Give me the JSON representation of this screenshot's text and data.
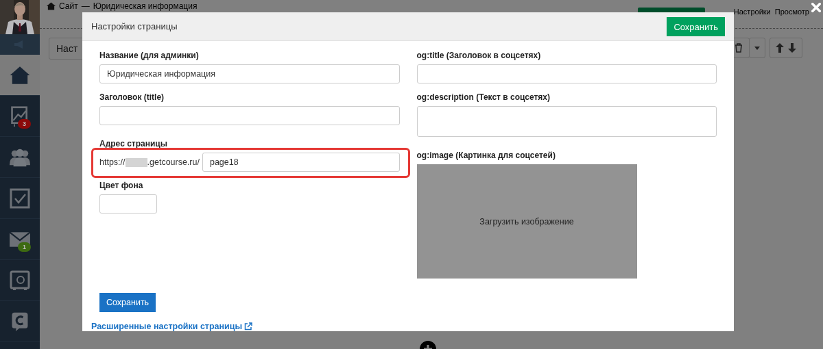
{
  "top_bar": {
    "breadcrumb": [
      "Сайт",
      "—",
      "Юридическая информация"
    ],
    "settings_link": "Настройки",
    "preview_link": "Просмотр"
  },
  "toolbar": {
    "settings_button": "Наст"
  },
  "sidebar": {
    "items": [
      {
        "kind": "home",
        "selected": true
      },
      {
        "kind": "chart",
        "selected": false,
        "badge": "3",
        "color": "#8b0a0a"
      },
      {
        "kind": "people",
        "selected": false
      },
      {
        "kind": "tasks",
        "selected": false
      },
      {
        "kind": "mail",
        "selected": false,
        "badge": "1",
        "color": "#3d6a12"
      },
      {
        "kind": "safe",
        "selected": false
      },
      {
        "kind": "chat",
        "selected": false
      }
    ]
  },
  "modal": {
    "title": "Настройки страницы",
    "header_button": "Сохранить",
    "left_fields": [
      {
        "kind": "input",
        "label": "Название (для админки)",
        "value": "Юридическая информация"
      },
      {
        "kind": "input",
        "label": "Заголовок (title)"
      },
      {
        "kind": "url",
        "label": "Адрес страницы",
        "prefix": "https://",
        "suffix": ".getcourse.ru/",
        "value": "page18",
        "highlighted": true
      },
      {
        "kind": "color",
        "label": "Цвет фона"
      }
    ],
    "right_fields": [
      {
        "kind": "input",
        "label": "og:title (Заголовок в соцсетях)"
      },
      {
        "kind": "textarea",
        "label": "og:description (Текст в соцсетях)"
      },
      {
        "label": "og:image (Картинка для соцсетей)",
        "button": "Загрузить изображение"
      }
    ],
    "save_button": "Сохранить",
    "advanced_link": "Расширенные настройки страницы"
  }
}
